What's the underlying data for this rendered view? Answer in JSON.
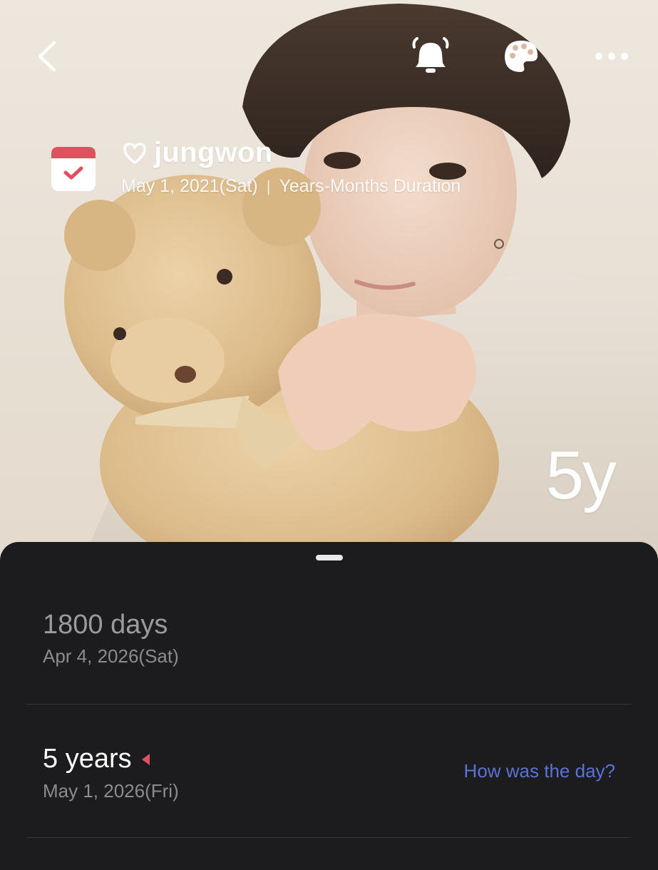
{
  "header": {
    "title": "jungwon",
    "start_date": "May 1, 2021(Sat)",
    "separator": "|",
    "count_mode": "Years-Months Duration",
    "big_count": "5y"
  },
  "icons": {
    "back": "chevron-left-icon",
    "alarm": "bell-icon",
    "theme": "palette-icon",
    "more": "more-horizontal-icon",
    "calendar": "calendar-check-icon",
    "heart": "heart-outline-icon",
    "marker": "triangle-marker-icon"
  },
  "milestones": [
    {
      "title": "1800 days",
      "date": "Apr 4, 2026(Sat)"
    },
    {
      "title": "5 years",
      "date": "May 1, 2026(Fri)",
      "action": "How was the day?"
    }
  ],
  "colors": {
    "sheet_bg": "#1c1c1e",
    "accent_red": "#e0505f",
    "link_blue": "#5a73d4"
  }
}
